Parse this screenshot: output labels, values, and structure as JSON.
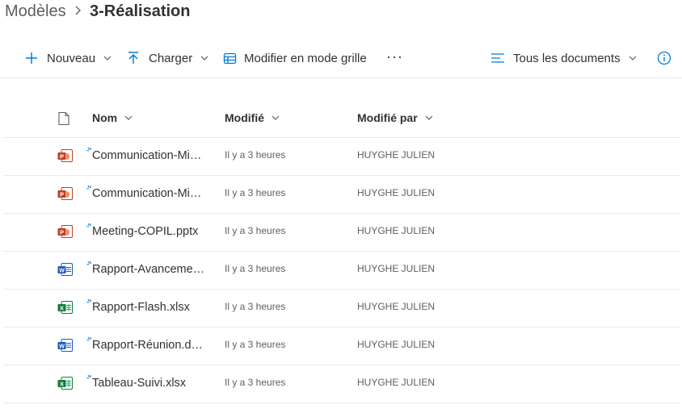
{
  "breadcrumb": {
    "parent": "Modèles",
    "current": "3-Réalisation"
  },
  "toolbar": {
    "new_label": "Nouveau",
    "upload_label": "Charger",
    "grid_label": "Modifier en mode grille",
    "more_label": "···",
    "view_label": "Tous les documents"
  },
  "columns": {
    "name": "Nom",
    "modified": "Modifié",
    "modified_by": "Modifié par"
  },
  "files": [
    {
      "name": "Communication-Mise-en-place.pptx",
      "type": "pptx",
      "modified": "Il y a 3 heures",
      "modified_by": "HUYGHE JULIEN"
    },
    {
      "name": "Communication-Mise-en-service.pptx",
      "type": "pptx",
      "modified": "Il y a 3 heures",
      "modified_by": "HUYGHE JULIEN"
    },
    {
      "name": "Meeting-COPIL.pptx",
      "type": "pptx",
      "modified": "Il y a 3 heures",
      "modified_by": "HUYGHE JULIEN"
    },
    {
      "name": "Rapport-Avancement.docx",
      "type": "docx",
      "modified": "Il y a 3 heures",
      "modified_by": "HUYGHE JULIEN"
    },
    {
      "name": "Rapport-Flash.xlsx",
      "type": "xlsx",
      "modified": "Il y a 3 heures",
      "modified_by": "HUYGHE JULIEN"
    },
    {
      "name": "Rapport-Réunion.docx",
      "type": "docx",
      "modified": "Il y a 3 heures",
      "modified_by": "HUYGHE JULIEN"
    },
    {
      "name": "Tableau-Suivi.xlsx",
      "type": "xlsx",
      "modified": "Il y a 3 heures",
      "modified_by": "HUYGHE JULIEN"
    }
  ],
  "colors": {
    "accent": "#0078d4",
    "pptx": "#c43e1c",
    "docx": "#185abd",
    "xlsx": "#107c41",
    "divider": "#edebe9"
  }
}
